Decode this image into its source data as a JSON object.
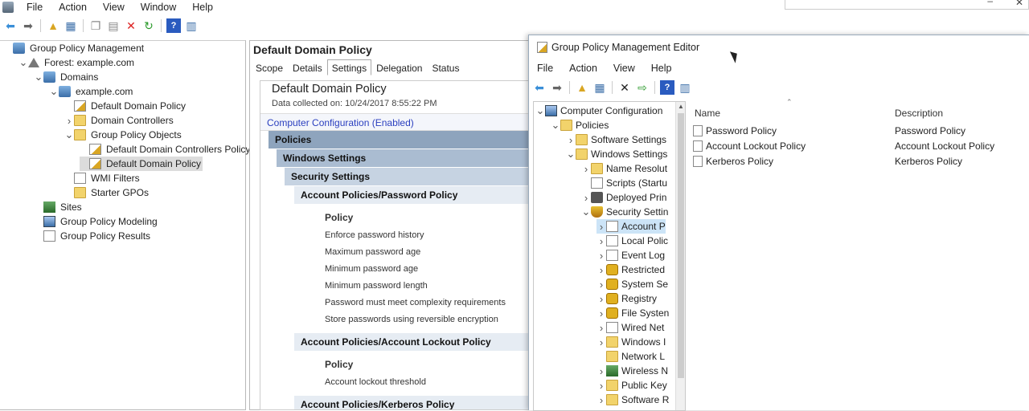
{
  "app": {
    "menu": [
      "File",
      "Action",
      "View",
      "Window",
      "Help"
    ]
  },
  "left_tree": [
    {
      "label": "Group Policy Management",
      "indent": 0,
      "icon": "gpm-icon",
      "chev": ""
    },
    {
      "label": "Forest: example.com",
      "indent": 1,
      "icon": "forest-icon",
      "chev": "v"
    },
    {
      "label": "Domains",
      "indent": 2,
      "icon": "domains-icon",
      "chev": "v"
    },
    {
      "label": "example.com",
      "indent": 3,
      "icon": "domain-icon",
      "chev": "v"
    },
    {
      "label": "Default Domain Policy",
      "indent": 4,
      "icon": "gpo-link-icon",
      "chev": ""
    },
    {
      "label": "Domain Controllers",
      "indent": 4,
      "icon": "folder-icon",
      "chev": ">"
    },
    {
      "label": "Group Policy Objects",
      "indent": 4,
      "icon": "folder-icon",
      "chev": "v"
    },
    {
      "label": "Default Domain Controllers Policy",
      "indent": 5,
      "icon": "gpo-icon",
      "chev": ""
    },
    {
      "label": "Default Domain Policy",
      "indent": 5,
      "icon": "gpo-icon",
      "chev": "",
      "selected": true
    },
    {
      "label": "WMI Filters",
      "indent": 4,
      "icon": "wmi-icon",
      "chev": ""
    },
    {
      "label": "Starter GPOs",
      "indent": 4,
      "icon": "folder-icon",
      "chev": ""
    },
    {
      "label": "Sites",
      "indent": 2,
      "icon": "sites-icon",
      "chev": ""
    },
    {
      "label": "Group Policy Modeling",
      "indent": 2,
      "icon": "modeling-icon",
      "chev": ""
    },
    {
      "label": "Group Policy Results",
      "indent": 2,
      "icon": "results-icon",
      "chev": ""
    }
  ],
  "gpo_panel": {
    "title": "Default Domain Policy",
    "tabs": [
      "Scope",
      "Details",
      "Settings",
      "Delegation",
      "Status"
    ],
    "active_tab": "Settings",
    "report_title": "Default Domain Policy",
    "collected": "Data collected on: 10/24/2017 8:55:22 PM",
    "computer_config": "Computer Configuration (Enabled)",
    "bands": {
      "policies": "Policies",
      "windows_settings": "Windows Settings",
      "security_settings": "Security Settings",
      "password_policy": "Account Policies/Password Policy",
      "lockout_policy": "Account Policies/Account Lockout Policy",
      "kerberos_policy": "Account Policies/Kerberos Policy"
    },
    "policy_header": "Policy",
    "password_items": [
      "Enforce password history",
      "Maximum password age",
      "Minimum password age",
      "Minimum password length",
      "Password must meet complexity requirements",
      "Store passwords using reversible encryption"
    ],
    "lockout_items": [
      "Account lockout threshold"
    ]
  },
  "editor": {
    "title": "Group Policy Management Editor",
    "menu": [
      "File",
      "Action",
      "View",
      "Help"
    ],
    "tree": [
      {
        "label": "Computer Configuration",
        "indent": 0,
        "chev": "v",
        "icon": "computer-icon"
      },
      {
        "label": "Policies",
        "indent": 1,
        "chev": "v",
        "icon": "folder-icon"
      },
      {
        "label": "Software Settings",
        "indent": 2,
        "chev": ">",
        "icon": "folder-icon"
      },
      {
        "label": "Windows Settings",
        "indent": 2,
        "chev": "v",
        "icon": "folder-icon"
      },
      {
        "label": "Name Resolut",
        "indent": 3,
        "chev": ">",
        "icon": "folder-icon"
      },
      {
        "label": "Scripts (Startu",
        "indent": 3,
        "chev": "",
        "icon": "doc-icon"
      },
      {
        "label": "Deployed Prin",
        "indent": 3,
        "chev": ">",
        "icon": "printer-icon"
      },
      {
        "label": "Security Settin",
        "indent": 3,
        "chev": "v",
        "icon": "shield-icon"
      },
      {
        "label": "Account P",
        "indent": 4,
        "chev": ">",
        "icon": "account-icon",
        "selected": true
      },
      {
        "label": "Local Polic",
        "indent": 4,
        "chev": ">",
        "icon": "doc-icon"
      },
      {
        "label": "Event Log",
        "indent": 4,
        "chev": ">",
        "icon": "doc-icon"
      },
      {
        "label": "Restricted",
        "indent": 4,
        "chev": ">",
        "icon": "lock-folder-icon"
      },
      {
        "label": "System Se",
        "indent": 4,
        "chev": ">",
        "icon": "lock-folder-icon"
      },
      {
        "label": "Registry",
        "indent": 4,
        "chev": ">",
        "icon": "lock-folder-icon"
      },
      {
        "label": "File Systen",
        "indent": 4,
        "chev": ">",
        "icon": "lock-folder-icon"
      },
      {
        "label": "Wired Net",
        "indent": 4,
        "chev": ">",
        "icon": "doc-icon"
      },
      {
        "label": "Windows I",
        "indent": 4,
        "chev": ">",
        "icon": "folder-icon"
      },
      {
        "label": "Network L",
        "indent": 4,
        "chev": "",
        "icon": "folder-icon"
      },
      {
        "label": "Wireless N",
        "indent": 4,
        "chev": ">",
        "icon": "network-icon"
      },
      {
        "label": "Public Key",
        "indent": 4,
        "chev": ">",
        "icon": "folder-icon"
      },
      {
        "label": "Software R",
        "indent": 4,
        "chev": ">",
        "icon": "folder-icon"
      }
    ],
    "columns": {
      "name": "Name",
      "description": "Description"
    },
    "rows": [
      {
        "name": "Password Policy",
        "description": "Password Policy"
      },
      {
        "name": "Account Lockout Policy",
        "description": "Account Lockout Policy"
      },
      {
        "name": "Kerberos Policy",
        "description": "Kerberos Policy"
      }
    ]
  }
}
